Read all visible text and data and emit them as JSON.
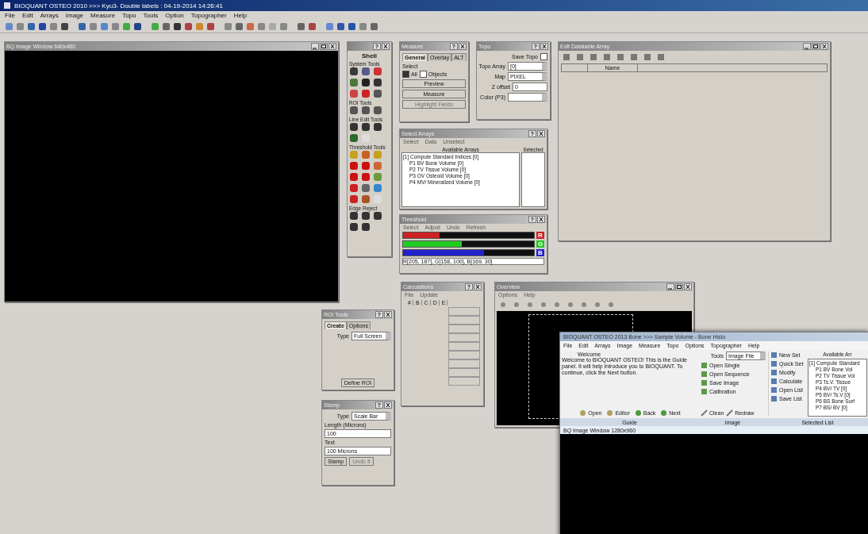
{
  "window": {
    "title": "BIOQUANT OSTEO 2010 >>> Kyu3- Double labels : 04-19-2014 14:26:41"
  },
  "menu": [
    "File",
    "Edit",
    "Arrays",
    "Image",
    "Measure",
    "Topo",
    "Tools",
    "Option",
    "Topographer",
    "Help"
  ],
  "image_window": {
    "title": "BQ Image Window 640x480"
  },
  "tools_window": {
    "help": "?",
    "title": "Shell",
    "sections": [
      {
        "label": "System Tools",
        "icons": [
          {
            "color": "#3a3a3a"
          },
          {
            "color": "#5a5a8a"
          },
          {
            "color": "#cc3333"
          },
          {
            "color": "#4a7a3a"
          },
          {
            "color": "#222222"
          },
          {
            "color": "#333333"
          },
          {
            "color": "#cc4444"
          },
          {
            "color": "#cc2222"
          },
          {
            "color": "#555555"
          }
        ]
      },
      {
        "label": "ROI Tools",
        "icons": [
          {
            "color": "#555555"
          },
          {
            "color": "#555555"
          },
          {
            "color": "#555555"
          }
        ]
      },
      {
        "label": "Line Edit Tools",
        "icons": [
          {
            "color": "#333333"
          },
          {
            "color": "#333333"
          },
          {
            "color": "#333333"
          },
          {
            "color": "#2a6a2a"
          },
          {
            "color": "#dddddd"
          }
        ]
      },
      {
        "label": "Threshold Tools",
        "icons": [
          {
            "color": "#c8a020"
          },
          {
            "color": "#c86020"
          },
          {
            "color": "#c8a020"
          },
          {
            "color": "#cc1111"
          },
          {
            "color": "#cc1111"
          },
          {
            "color": "#cc6633"
          },
          {
            "color": "#cc1111"
          },
          {
            "color": "#cc1111"
          },
          {
            "color": "#6a9a3a"
          },
          {
            "color": "#cc2222"
          },
          {
            "color": "#666666"
          },
          {
            "color": "#3388cc"
          },
          {
            "color": "#cc2222"
          },
          {
            "color": "#aa5522"
          },
          {
            "color": "#dddddd"
          }
        ]
      },
      {
        "label": "Edge Reject",
        "icons": [
          {
            "color": "#333333"
          },
          {
            "color": "#333333"
          },
          {
            "color": "#333333"
          },
          {
            "color": "#333333"
          },
          {
            "color": "#333333"
          }
        ]
      }
    ]
  },
  "measure_window": {
    "title": "Measure",
    "help": "?",
    "tabs": [
      {
        "label": "General",
        "selected": true
      },
      {
        "label": "Overlay",
        "selected": false
      },
      {
        "label": "ALT",
        "selected": false
      }
    ],
    "select_label": "Select",
    "options": [
      {
        "label": "All",
        "checked": true
      },
      {
        "label": "Objects",
        "checked": false
      }
    ],
    "buttons": [
      {
        "label": "Preview",
        "disabled": false
      },
      {
        "label": "Measure",
        "disabled": false
      },
      {
        "label": "Highlight Fields",
        "disabled": true
      }
    ]
  },
  "topo_window": {
    "title": "Topo",
    "help": "?",
    "save_label": "Save Topo",
    "save_checked": false,
    "fields": [
      {
        "label": "Topo Array",
        "value": "[0]",
        "kind": "dropdown"
      },
      {
        "label": "Map",
        "value": "PIXEL",
        "kind": "dropdown"
      },
      {
        "label": "Z offset",
        "value": "0",
        "kind": "text"
      },
      {
        "label": "Color (P3)",
        "kind": "dropdown"
      }
    ]
  },
  "table_window": {
    "title": "Edit Datatable Array",
    "columns": [
      "",
      "Name"
    ]
  },
  "arrays_window": {
    "title": "Select Arrays",
    "help": "?",
    "menu": [
      "Select",
      "Data",
      "Unselect"
    ],
    "available_label": "Available Arrays",
    "selected_label": "Selected",
    "items": [
      {
        "label": "[1] Compute Standard Indices [0]",
        "children": [
          {
            "label": "P1 BV Bone Volume [0]"
          },
          {
            "label": "P2 TV Tissue Volume [0]"
          },
          {
            "label": "P3 OV Osteoid Volume [0]"
          },
          {
            "label": "P4 MV/ Mineralized Volume [0]"
          }
        ]
      }
    ]
  },
  "threshold_window": {
    "title": "Threshold",
    "help": "?",
    "menu": [
      "Select",
      "Adjust",
      "Undo",
      "Refresh"
    ],
    "channels": [
      {
        "name": "R",
        "color": "#cc2222",
        "level": 0.28
      },
      {
        "name": "G",
        "color": "#22cc22",
        "level": 0.45
      },
      {
        "name": "B",
        "color": "#2222cc",
        "level": 0.62
      }
    ],
    "reading": "R[205, 187],  G[158, 100],  B[169, 30]"
  },
  "calc_window": {
    "title": "Calculations",
    "help": "?",
    "menu": [
      "File",
      "Update"
    ],
    "columns": [
      "#",
      "B",
      "C",
      "D",
      "E"
    ]
  },
  "overview_window": {
    "title": "Overview",
    "menu": [
      "Options",
      "Help"
    ]
  },
  "roi_window": {
    "title": "ROI Tools",
    "help": "?",
    "tabs": [
      {
        "label": "Create",
        "selected": true
      },
      {
        "label": "Options",
        "selected": false
      }
    ],
    "type_label": "Type",
    "type_value": "Full Screen",
    "button": "Define ROI"
  },
  "stamp_window": {
    "title": "Stamp",
    "help": "?",
    "type_label": "Type",
    "type_value": "Scale Bar",
    "length_label": "Length (Microns)",
    "length_value": "100",
    "text_label": "Text",
    "text_value": "100 Microns",
    "buttons": [
      {
        "label": "Stamp",
        "disabled": false
      },
      {
        "label": "Undo It",
        "disabled": true
      }
    ]
  },
  "front_window": {
    "title": "BIOQUANT OSTEO 2013 Bone >>> Sample Volume - Bone Histo",
    "menu": [
      "File",
      "Edit",
      "Arrays",
      "Image",
      "Measure",
      "Topo",
      "Options",
      "Topographer",
      "Help"
    ],
    "guide_heading": "Welcome",
    "guide_text": "Welcome to BIOQUANT OSTEO! This is the Guide panel. It will help introduce you to BIOQUANT. To continue, click the Next button.",
    "guide_buttons": [
      "Open",
      "Editor",
      "Back",
      "Next"
    ],
    "tools_label": "Tools",
    "tools_value": "Image File",
    "tool_actions": [
      "Open Single",
      "Open Sequence",
      "Save Image",
      "Calibration"
    ],
    "tool_buttons": [
      "Clean",
      "Redraw"
    ],
    "set_actions": [
      "New Set",
      "Quick Set",
      "Modify",
      "Calculate",
      "Open List",
      "Save List"
    ],
    "available_label": "Available Arr",
    "available": [
      "[1] Compute Standard",
      "P1 BV Bone Vol",
      "P2 TV Tissue Vol",
      "P3 Ts.V. Tissue",
      "P4 BV/ TV [0]",
      "P5 BV/ Ts.V [0]",
      "P6 BS Bone Surf",
      "P7 BS/ BV [0]"
    ],
    "sections": [
      "Guide",
      "Image",
      "Selected List"
    ],
    "image_title": "BQ Image Window 1280x960"
  }
}
